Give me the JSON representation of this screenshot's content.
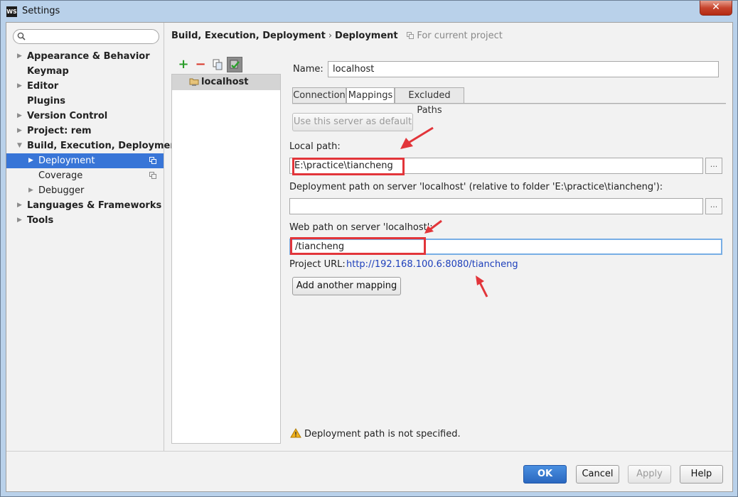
{
  "window": {
    "app_icon": "WS",
    "title": "Settings",
    "close_symbol": "✕"
  },
  "sidebar": {
    "search_placeholder": "",
    "items": [
      {
        "label": "Appearance & Behavior",
        "arrow": "▶"
      },
      {
        "label": "Keymap"
      },
      {
        "label": "Editor",
        "arrow": "▶"
      },
      {
        "label": "Plugins"
      },
      {
        "label": "Version Control",
        "arrow": "▶"
      },
      {
        "label": "Project: rem",
        "arrow": "▶"
      },
      {
        "label": "Build, Execution, Deployment",
        "arrow": "▼"
      },
      {
        "label": "Deployment",
        "arrow": "▶"
      },
      {
        "label": "Coverage"
      },
      {
        "label": "Debugger",
        "arrow": "▶"
      },
      {
        "label": "Languages & Frameworks",
        "arrow": "▶"
      },
      {
        "label": "Tools",
        "arrow": "▶"
      }
    ]
  },
  "breadcrumb": {
    "parent": "Build, Execution, Deployment",
    "separator": "›",
    "current": "Deployment",
    "scope": "For current project"
  },
  "toolbar": {
    "add": "+",
    "remove": "−"
  },
  "servers": [
    {
      "name": "localhost"
    }
  ],
  "form": {
    "name_label": "Name:",
    "name_value": "localhost",
    "tabs": [
      "Connection",
      "Mappings",
      "Excluded Paths"
    ],
    "active_tab": "Mappings",
    "default_button": "Use this server as default",
    "local_path_label": "Local path:",
    "local_path_value": "E:\\practice\\tiancheng",
    "deployment_path_label": "Deployment path on server 'localhost' (relative to folder 'E:\\practice\\tiancheng'):",
    "deployment_path_value": "",
    "web_path_label": "Web path on server 'localhost':",
    "web_path_value": "/tiancheng",
    "project_url_label": "Project URL:",
    "project_url_value": "http://192.168.100.6:8080/tiancheng",
    "add_mapping_button": "Add another mapping",
    "browse": "...",
    "warning": "Deployment path is not specified."
  },
  "footer": {
    "ok": "OK",
    "cancel": "Cancel",
    "apply": "Apply",
    "help": "Help"
  },
  "colors": {
    "selection": "#3875d7",
    "highlight": "#e2353a",
    "link": "#1d3fbb"
  }
}
